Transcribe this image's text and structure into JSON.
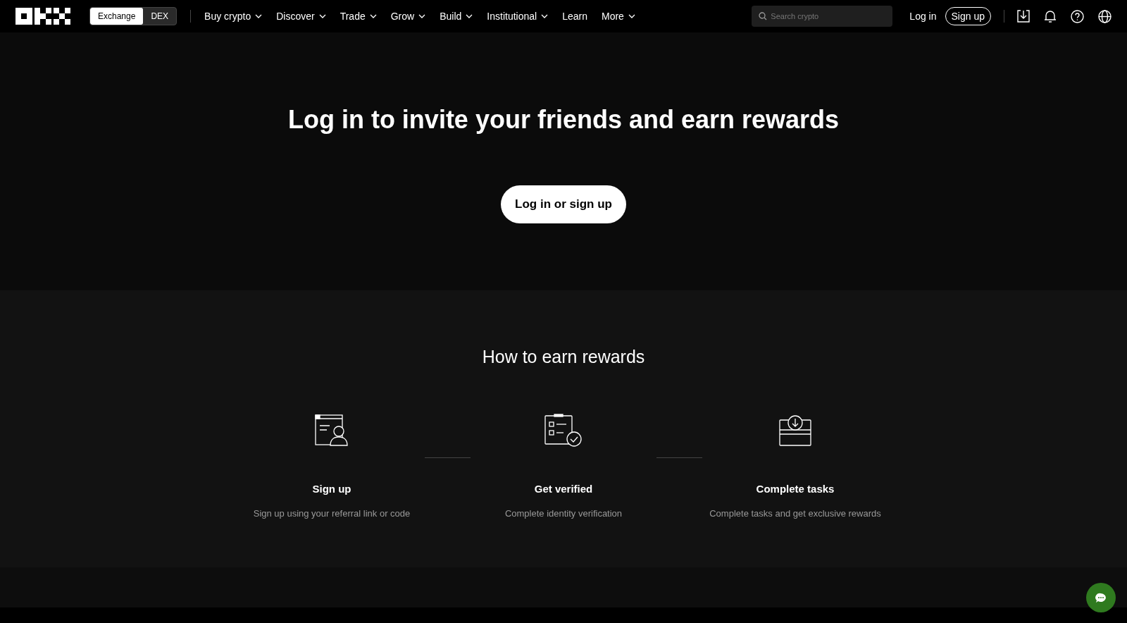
{
  "header": {
    "toggle": [
      {
        "label": "Exchange",
        "selected": true
      },
      {
        "label": "DEX",
        "selected": false
      }
    ],
    "nav": [
      {
        "label": "Buy crypto",
        "has_menu": true
      },
      {
        "label": "Discover",
        "has_menu": true
      },
      {
        "label": "Trade",
        "has_menu": true
      },
      {
        "label": "Grow",
        "has_menu": true
      },
      {
        "label": "Build",
        "has_menu": true
      },
      {
        "label": "Institutional",
        "has_menu": true
      },
      {
        "label": "Learn",
        "has_menu": false
      },
      {
        "label": "More",
        "has_menu": true
      }
    ],
    "search": {
      "placeholder": "Search crypto"
    },
    "login": "Log in",
    "signup": "Sign up"
  },
  "hero": {
    "title": "Log in to invite your friends and earn rewards",
    "button": "Log in or sign up"
  },
  "how": {
    "title": "How to earn rewards",
    "steps": [
      {
        "kind": "profile",
        "title": "Sign up",
        "text": "Sign up using your referral link or code"
      },
      {
        "kind": "checklist",
        "title": "Get verified",
        "text": "Complete identity verification"
      },
      {
        "kind": "inbox",
        "title": "Complete tasks",
        "text": "Complete tasks and get exclusive rewards"
      }
    ]
  }
}
